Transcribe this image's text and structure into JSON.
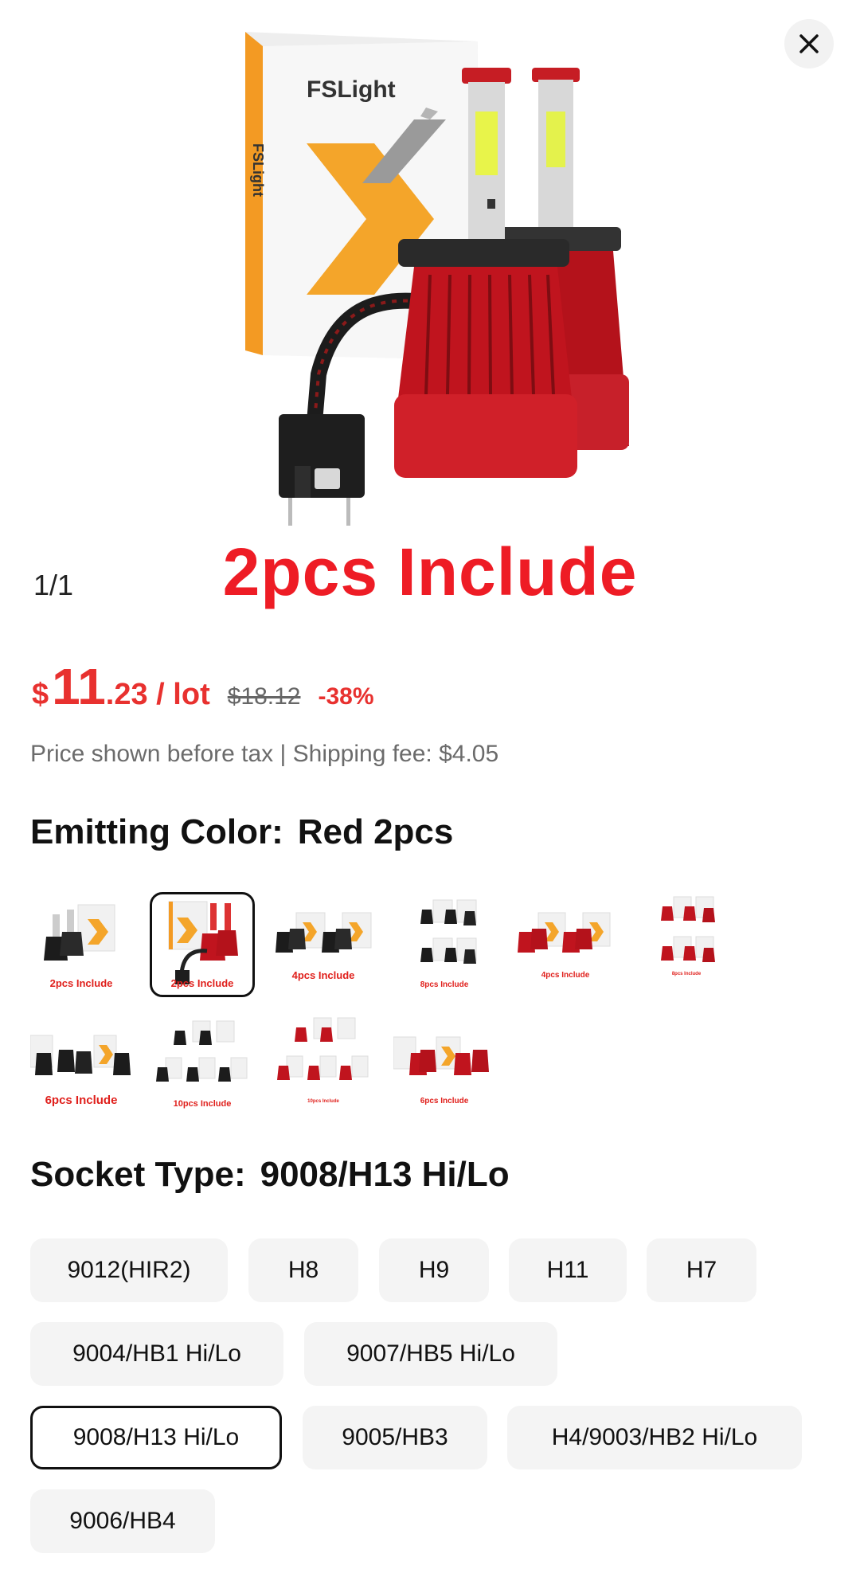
{
  "hero": {
    "caption": "2pcs Include",
    "counter": "1/1",
    "box_brand": "FSLight",
    "box_side_text": "FSLight"
  },
  "close": {
    "icon": "close-icon"
  },
  "price": {
    "currency": "$",
    "integer": "11",
    "decimal_unit": ".23 / lot",
    "original": "$18.12",
    "discount": "-38%",
    "accent_color": "#e8312f"
  },
  "tax_line": "Price shown before tax | Shipping fee: $4.05",
  "emitting_color": {
    "label": "Emitting Color:",
    "selected": "Red 2pcs",
    "options": [
      {
        "caption": "2pcs Include",
        "bulb": "black",
        "pairs": 1
      },
      {
        "caption": "2pcs Include",
        "bulb": "red",
        "pairs": 1,
        "selected": true
      },
      {
        "caption": "4pcs Include",
        "bulb": "black",
        "pairs": 2
      },
      {
        "caption": "8pcs Include",
        "bulb": "black",
        "pairs": 4
      },
      {
        "caption": "4pcs Include",
        "bulb": "red",
        "pairs": 2
      },
      {
        "caption": "8pcs Include",
        "bulb": "red",
        "pairs": 4
      },
      {
        "caption": "6pcs Include",
        "bulb": "black",
        "pairs": 3
      },
      {
        "caption": "10pcs Include",
        "bulb": "black",
        "pairs": 5
      },
      {
        "caption": "10pcs Include",
        "bulb": "red",
        "pairs": 5
      },
      {
        "caption": "6pcs Include",
        "bulb": "red",
        "pairs": 3
      }
    ]
  },
  "socket_type": {
    "label": "Socket Type:",
    "selected": "9008/H13 Hi/Lo",
    "options": [
      "9012(HIR2)",
      "H8",
      "H9",
      "H11",
      "H7",
      "9004/HB1 Hi/Lo",
      "9007/HB5 Hi/Lo",
      "9008/H13 Hi/Lo",
      "9005/HB3",
      "H4/9003/HB2 Hi/Lo",
      "9006/HB4"
    ]
  }
}
